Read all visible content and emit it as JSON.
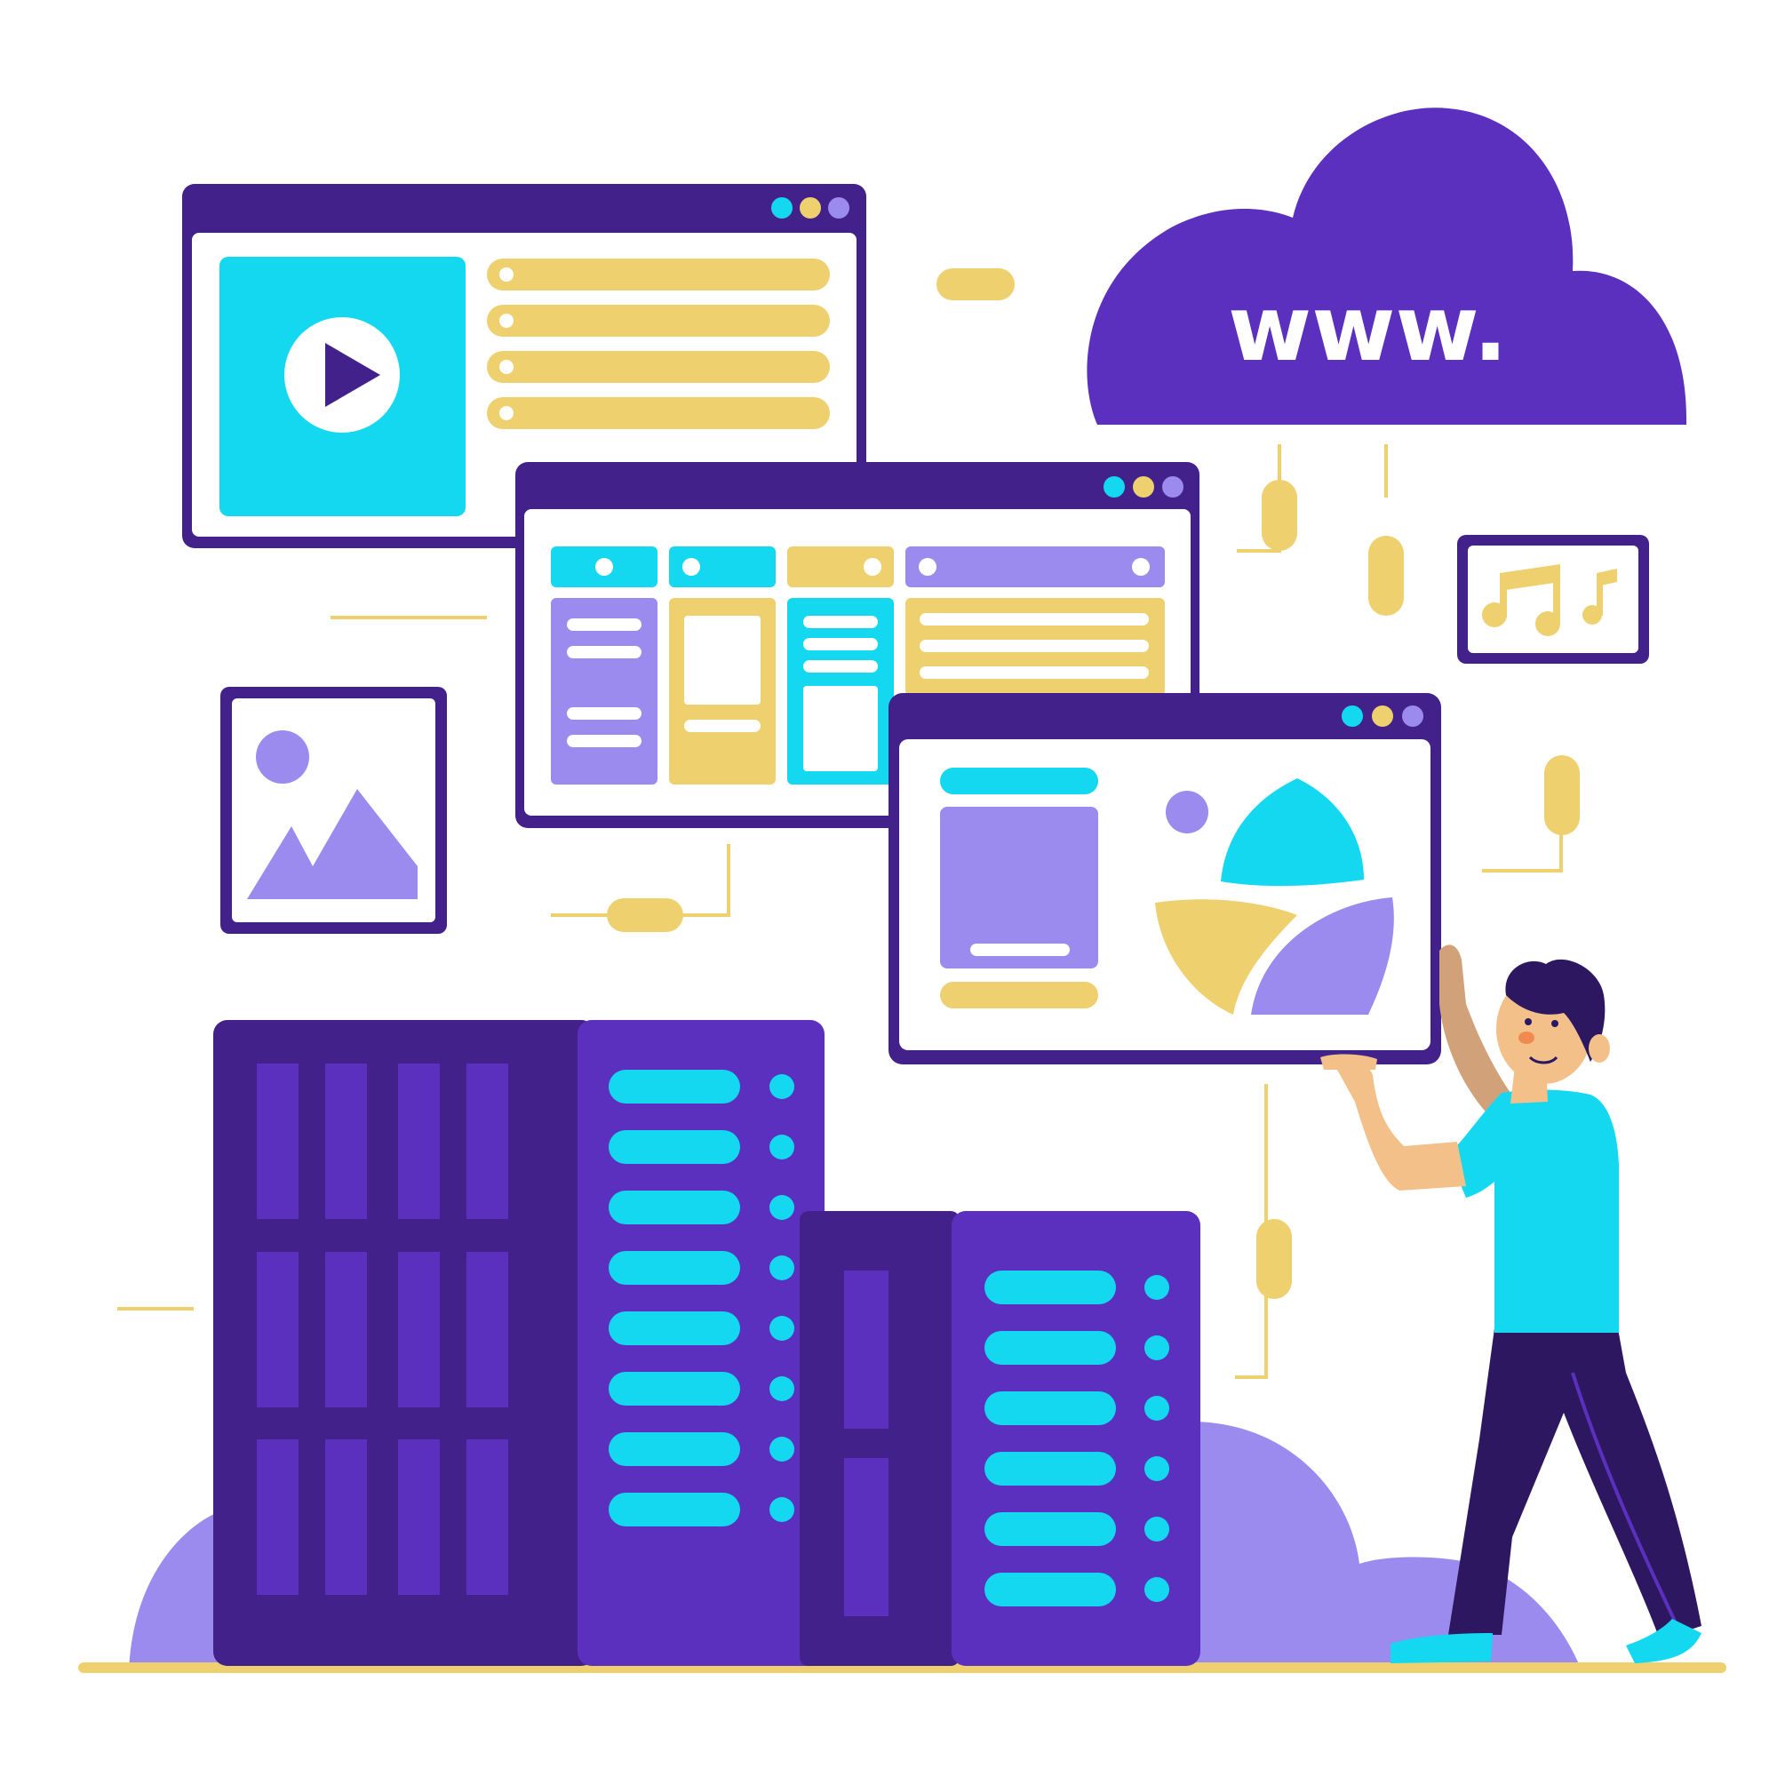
{
  "colors": {
    "dark_purple": "#42228A",
    "purple": "#5B30BE",
    "lavender": "#9B8BEE",
    "cyan": "#13D8F0",
    "yellow": "#EFD06F",
    "outline": "#2C1760",
    "skin": "#F4C08A",
    "white": "#FFFFFF"
  },
  "cloud": {
    "text": "www."
  },
  "icons": {
    "video_window": "play-icon",
    "image_frame": "image-icon",
    "music_frame": "music-notes-icon",
    "photo_window": "landscape-icon"
  },
  "server_racks": {
    "left_rack_slots": 8,
    "right_rack_slots": 6
  }
}
